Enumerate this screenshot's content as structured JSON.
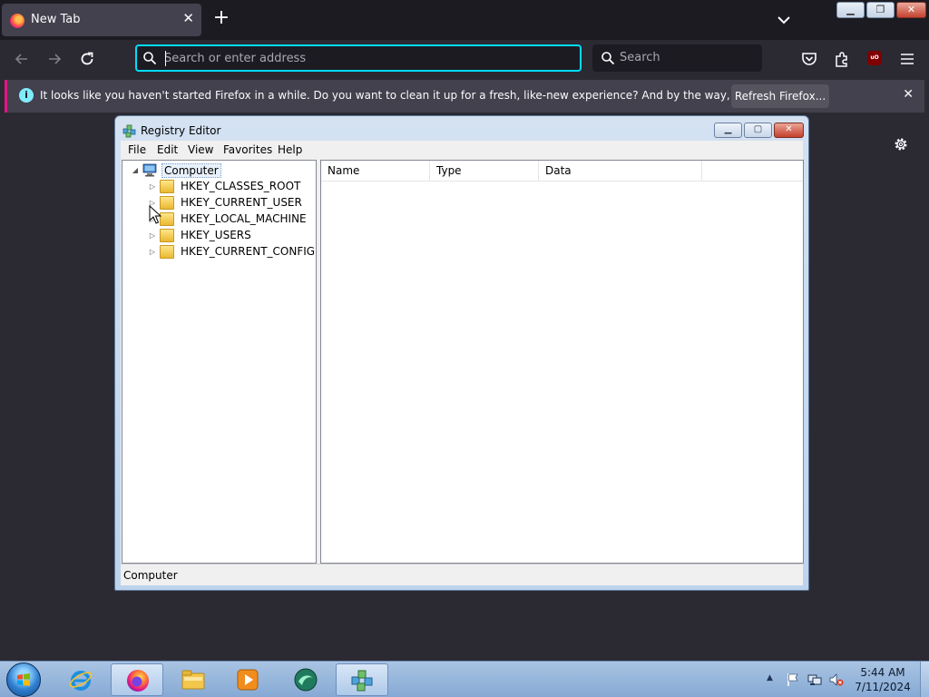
{
  "browser": {
    "tab": {
      "title": "New Tab",
      "close_glyph": "✕",
      "favicon": "firefox-logo-icon"
    },
    "new_tab_glyph": "+",
    "window_buttons": {
      "minimize": "▁",
      "restore": "❐",
      "close": "✕"
    },
    "urlbar": {
      "placeholder": "Search or enter address",
      "value": ""
    },
    "searchbar": {
      "placeholder": "Search"
    },
    "notification": {
      "message": "It looks like you haven't started Firefox in a while. Do you want to clean it up for a fresh, like-new experience? And by the way, welcome back!",
      "button_label": "Refresh Firefox...",
      "close_glyph": "✕",
      "info_glyph": "i"
    },
    "ublock_badge": "uO",
    "accent_color": "#00ddff"
  },
  "regedit": {
    "title": "Registry Editor",
    "window_buttons": {
      "minimize": "▁",
      "restore": "▢",
      "close": "✕"
    },
    "menu": [
      "File",
      "Edit",
      "View",
      "Favorites",
      "Help"
    ],
    "tree": {
      "root": {
        "label": "Computer",
        "expander": "◢"
      },
      "children": [
        {
          "label": "HKEY_CLASSES_ROOT",
          "expander": "▷"
        },
        {
          "label": "HKEY_CURRENT_USER",
          "expander": "▷"
        },
        {
          "label": "HKEY_LOCAL_MACHINE",
          "expander": "▷"
        },
        {
          "label": "HKEY_USERS",
          "expander": "▷"
        },
        {
          "label": "HKEY_CURRENT_CONFIG",
          "expander": "▷"
        }
      ]
    },
    "columns": [
      "Name",
      "Type",
      "Data"
    ],
    "status": "Computer"
  },
  "taskbar": {
    "apps": [
      "internet-explorer-icon",
      "firefox-icon",
      "file-explorer-icon",
      "media-player-icon",
      "app-icon",
      "regedit-icon"
    ],
    "tray_arrow": "▲",
    "clock": {
      "time": "5:44 AM",
      "date": "7/11/2024"
    }
  }
}
